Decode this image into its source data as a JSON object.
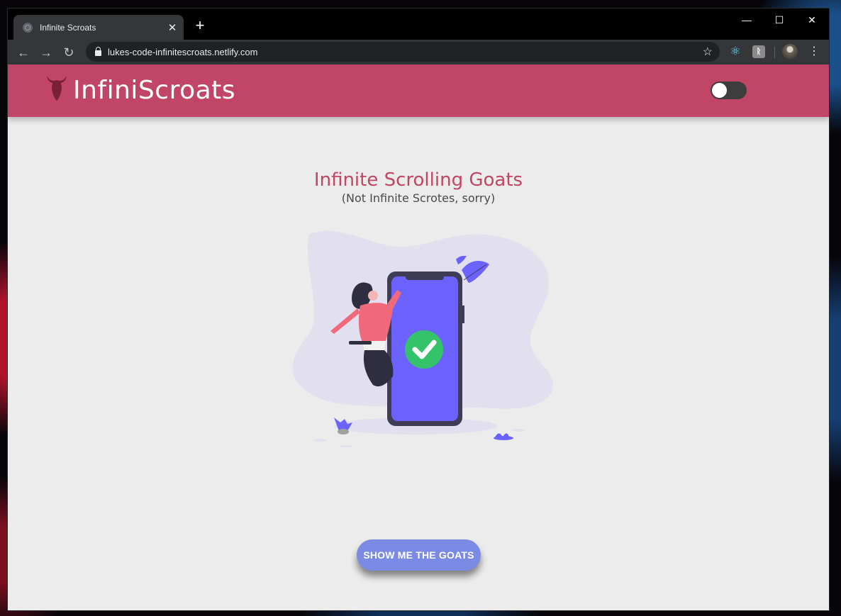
{
  "browser": {
    "tab_title": "Infinite Scroats",
    "tab_close": "✕",
    "new_tab": "+",
    "window_controls": {
      "minimize": "—",
      "maximize": "☐",
      "close": "✕"
    },
    "nav": {
      "back": "←",
      "forward": "→",
      "reload": "↻"
    },
    "url": "lukes-code-infinitescroats.netlify.com",
    "star": "☆",
    "extensions": [
      {
        "icon": "react-devtools-icon",
        "glyph": "⚛"
      },
      {
        "icon": "extension-icon",
        "glyph": "ᚱ"
      }
    ],
    "menu": "⋮"
  },
  "app": {
    "brand": "InfiniScroats",
    "logo_icon": "goat-head-icon",
    "theme_toggle": {
      "state": "off"
    },
    "colors": {
      "brand": "#c14566",
      "button": "#7b8ae4",
      "phone": "#6c63ff",
      "check": "#34c36a"
    }
  },
  "hero": {
    "title": "Infinite Scrolling Goats",
    "subtitle": "(Not Infinite Scrotes, sorry)"
  },
  "cta": {
    "label": "SHOW ME THE GOATS"
  }
}
